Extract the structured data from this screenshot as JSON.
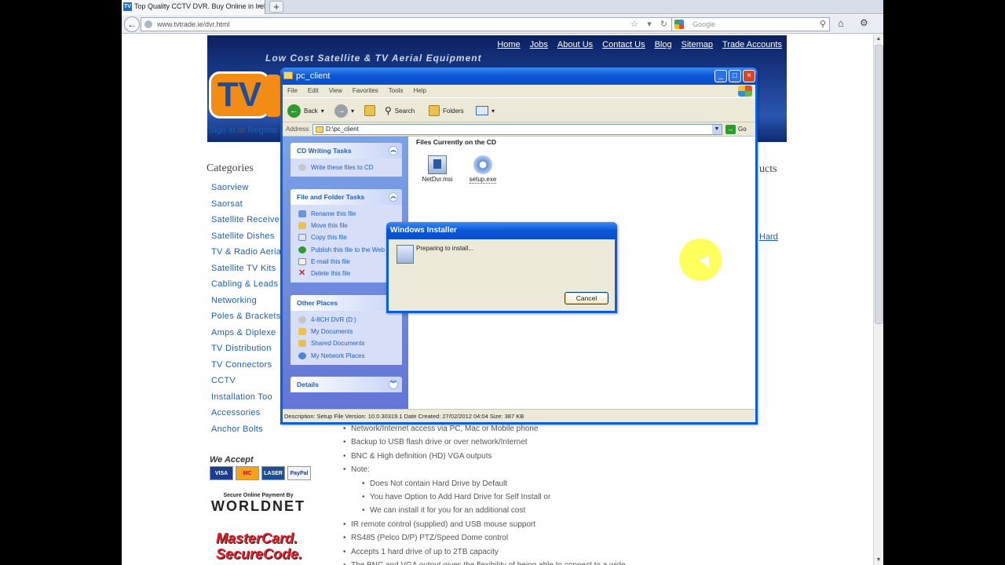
{
  "browser": {
    "tab_title": "Top Quality CCTV DVR. Buy Online in Ireland...",
    "tab_favicon": "TV",
    "tab_close": "×",
    "new_tab": "+",
    "back": "←",
    "url": "www.tvtrade.ie/dvr.html",
    "search_placeholder": "Google",
    "url_icons": "☆ ▾ ↻",
    "home_icon": "⌂",
    "tools_icon": "⚙"
  },
  "site": {
    "banner_text": "Low Cost Satellite & TV Aerial Equipment",
    "logo": "TV",
    "nav": [
      "Home",
      "Jobs",
      "About Us",
      "Contact Us",
      "Blog",
      "Sitemap",
      "Trade Accounts"
    ],
    "signin": "Sign in",
    "or": "or",
    "register": "Registe",
    "categories_title": "Categories",
    "categories": [
      "Saorview",
      "Saorsat",
      "Satellite Receive",
      "Satellite Dishes",
      "TV & Radio Aeria",
      "Satellite TV Kits",
      "Cabling & Leads",
      "Networking",
      "Poles & Brackets",
      "Amps & Diplexe",
      "TV Distribution",
      "TV Connectors",
      "CCTV",
      "Installation Too",
      "Accessories",
      "Anchor Bolts"
    ],
    "right_heading": "ucts",
    "right_link": "Hard",
    "we_accept": "We Accept",
    "cards": [
      "VISA",
      "MC",
      "LASER",
      "PayPal"
    ],
    "worldnet_small": "Secure Online Payment By",
    "worldnet_big": "WORLDNET",
    "mastercard1": "MasterCard.",
    "mastercard2": "SecureCode.",
    "features": [
      {
        "t": "Network/Internet access via PC, Mac or Mobile phone",
        "sub": false
      },
      {
        "t": "Backup to USB flash drive or over network/Internet",
        "sub": false
      },
      {
        "t": "BNC & High definition (HD) VGA outputs",
        "sub": false
      },
      {
        "t": "Note:",
        "sub": false
      },
      {
        "t": "Does Not contain Hard Drive by Default",
        "sub": true
      },
      {
        "t": "You have Option to Add Hard Drive for Self Install or",
        "sub": true
      },
      {
        "t": "We can install it for you for an additional cost",
        "sub": true
      },
      {
        "t": "IR remote control (supplied) and USB mouse support",
        "sub": false
      },
      {
        "t": "RS485 (Pelco D/P) PTZ/Speed Dome control",
        "sub": false
      },
      {
        "t": "Accepts 1 hard drive of up to 2TB capacity",
        "sub": false
      },
      {
        "t": "The BNC and VGA output gives the flexibility of being able to connect to a wide",
        "sub": false
      }
    ]
  },
  "explorer": {
    "title": "pc_client",
    "menu": [
      "File",
      "Edit",
      "View",
      "Favorites",
      "Tools",
      "Help"
    ],
    "toolbar": {
      "back": "Back",
      "search": "Search",
      "folders": "Folders"
    },
    "address_label": "Address",
    "address": "D:\\pc_client",
    "go": "Go",
    "panel_cd": {
      "title": "CD Writing Tasks",
      "items": [
        "Write these files to CD"
      ]
    },
    "panel_file": {
      "title": "File and Folder Tasks",
      "items": [
        "Rename this file",
        "Move this file",
        "Copy this file",
        "Publish this file to the Web",
        "E-mail this file",
        "Delete this file"
      ]
    },
    "panel_other": {
      "title": "Other Places",
      "items": [
        "4-8CH DVR (D:)",
        "My Documents",
        "Shared Documents",
        "My Network Places"
      ]
    },
    "panel_details": {
      "title": "Details"
    },
    "content_heading": "Files Currently on the CD",
    "files": [
      "NetDvr.msi",
      "setup.exe"
    ],
    "status": "Description: Setup File Version: 10.0.30319.1 Date Created: 27/02/2012 04:04 Size: 387 KB"
  },
  "installer": {
    "title": "Windows Installer",
    "message": "Preparing to install...",
    "cancel": "Cancel"
  }
}
